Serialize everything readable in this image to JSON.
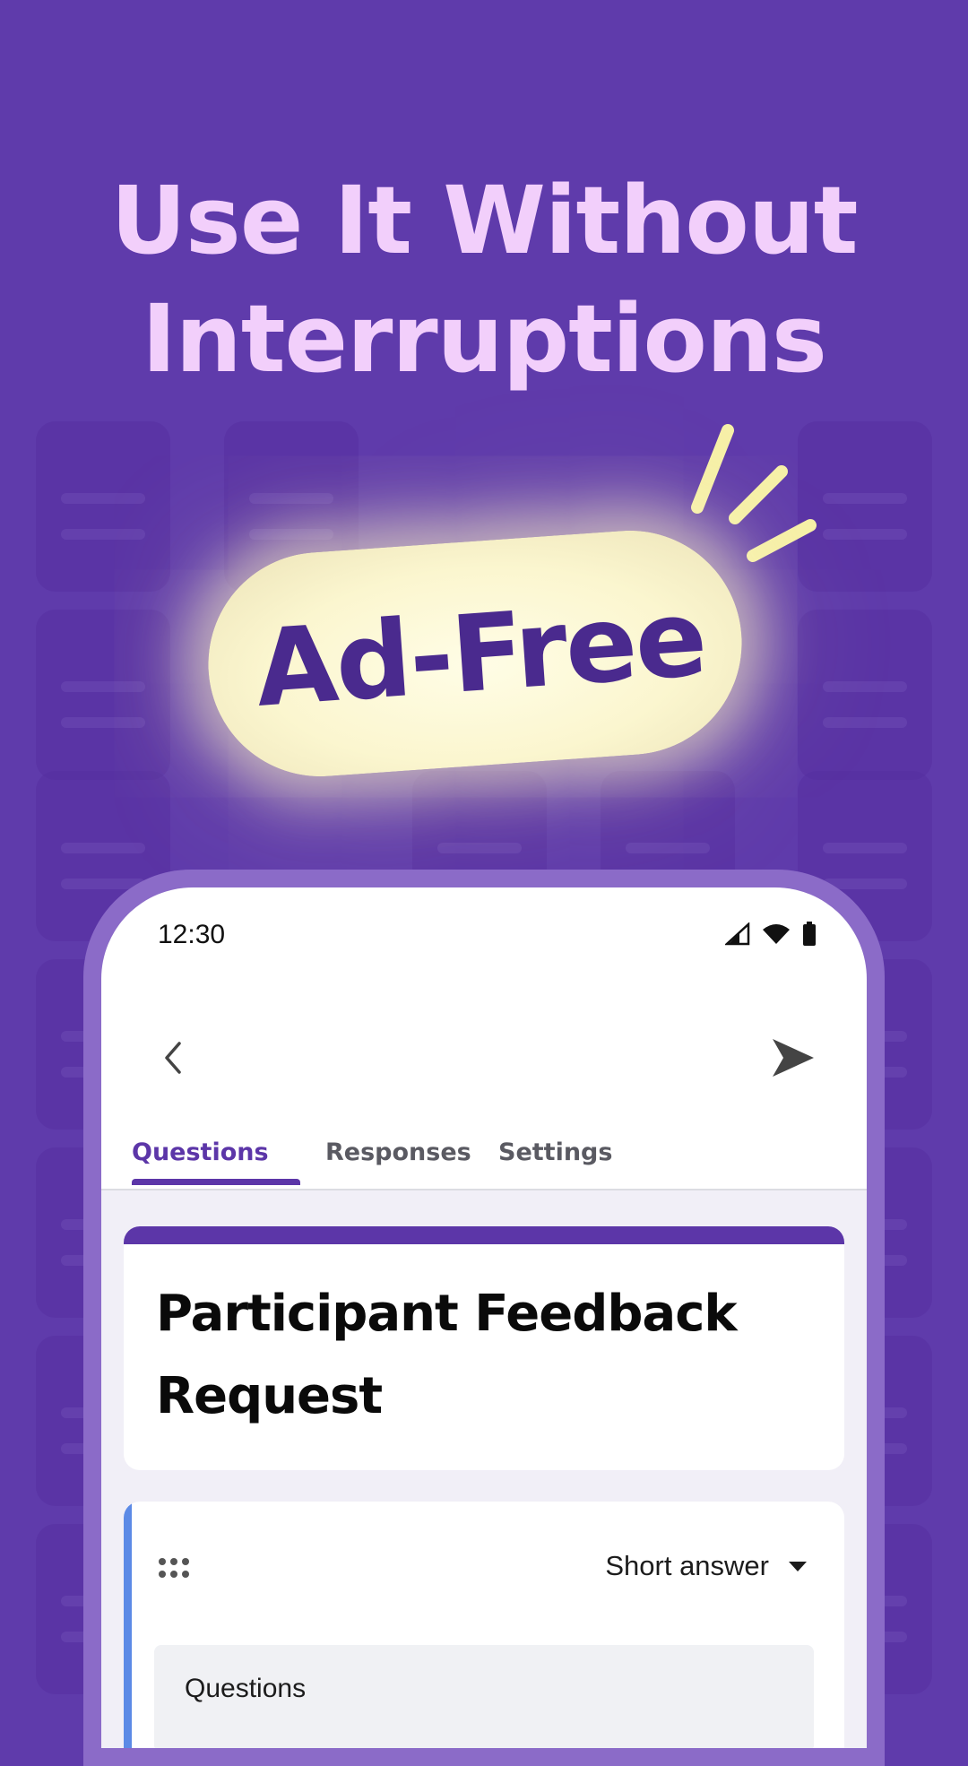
{
  "promo": {
    "headline_line1": "Use It Without",
    "headline_line2": "Interruptions",
    "badge": "Ad-Free"
  },
  "colors": {
    "background": "#5f3bab",
    "headline": "#f2cffb",
    "badge_fill": "#fbf6cf",
    "badge_text": "#4a2a8e",
    "accent": "#5c36a8",
    "question_bar": "#5c8ae6"
  },
  "status_bar": {
    "time": "12:30",
    "icons": [
      "signal-icon",
      "wifi-icon",
      "battery-icon"
    ]
  },
  "app_bar": {
    "back_icon": "chevron-left-icon",
    "send_icon": "send-icon"
  },
  "tabs": [
    {
      "label": "Questions",
      "active": true
    },
    {
      "label": "Responses",
      "active": false
    },
    {
      "label": "Settings",
      "active": false
    }
  ],
  "form": {
    "title": "Participant Feedback Request"
  },
  "question": {
    "handle_icon": "drag-handle-icon",
    "type_selected": "Short answer",
    "type_dropdown_icon": "caret-down-icon",
    "input_value": "Questions"
  }
}
